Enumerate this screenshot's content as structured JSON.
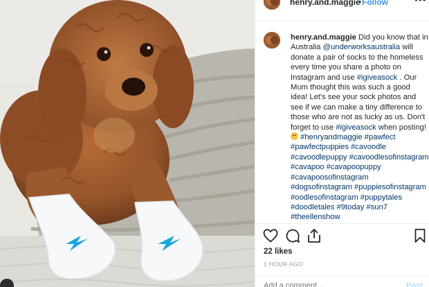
{
  "post": {
    "username": "henry.and.maggie",
    "separator": "•",
    "follow_label": "Follow",
    "more_label": "•••",
    "photo_alt_icon": "dog-in-socks-photo",
    "brand_color": "#3897f0",
    "link_color": "#003569"
  },
  "caption": {
    "username": "henry.and.maggie",
    "text1": " Did you know that in Australia ",
    "mention": "@underworksaustralia",
    "text2": " will donate a pair of socks to the homeless every time you share a photo on Instagram and use ",
    "tag_main": "#igiveasock",
    "text3": " . Our Mum thought this was such a good idea! Let's see your sock photos and see if we can make a tiny difference to those who are not as lucky as us. Don't forget to use ",
    "tag_main2": "#igiveasock",
    "text4": " when posting! ",
    "emoji": "smiling-face-emoji",
    "hashtags": [
      "#henryandmaggie",
      "#pawfect",
      "#pawfectpuppies",
      "#cavoodle",
      "#cavoodlepuppy",
      "#cavoodlesofinstagram",
      "#cavapoo",
      "#cavapoopuppy",
      "#cavapoosofinstagram",
      "#dogsofinstagram",
      "#puppiesofinstagram",
      "#oodlesofinstagram",
      "#puppytales",
      "#doodletales",
      "#9today",
      "#sun7",
      "#theellenshow"
    ]
  },
  "actions": {
    "like_icon": "heart-icon",
    "comment_icon": "comment-icon",
    "share_icon": "share-icon",
    "save_icon": "bookmark-icon"
  },
  "likes": "22 likes",
  "time_ago": "1 HOUR AGO",
  "add_comment": {
    "placeholder": "Add a comment…"
  },
  "post_button": "Post"
}
